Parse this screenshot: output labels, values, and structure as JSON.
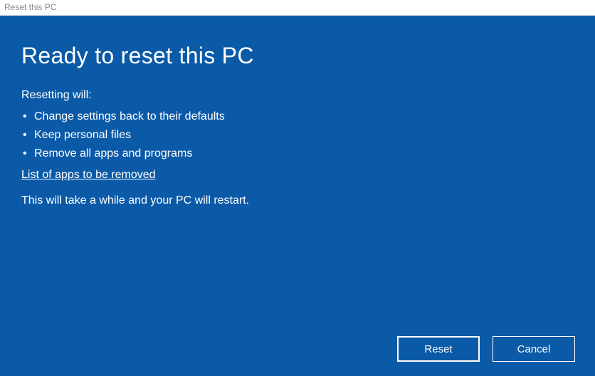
{
  "titlebar": {
    "title": "Reset this PC"
  },
  "main": {
    "heading": "Ready to reset this PC",
    "intro": "Resetting will:",
    "bullets": [
      "Change settings back to their defaults",
      "Keep personal files",
      "Remove all apps and programs"
    ],
    "link_text": "List of apps to be removed",
    "note": "This will take a while and your PC will restart."
  },
  "buttons": {
    "reset": "Reset",
    "cancel": "Cancel"
  },
  "colors": {
    "panel_bg": "#0b5aa8",
    "text": "#ffffff"
  }
}
